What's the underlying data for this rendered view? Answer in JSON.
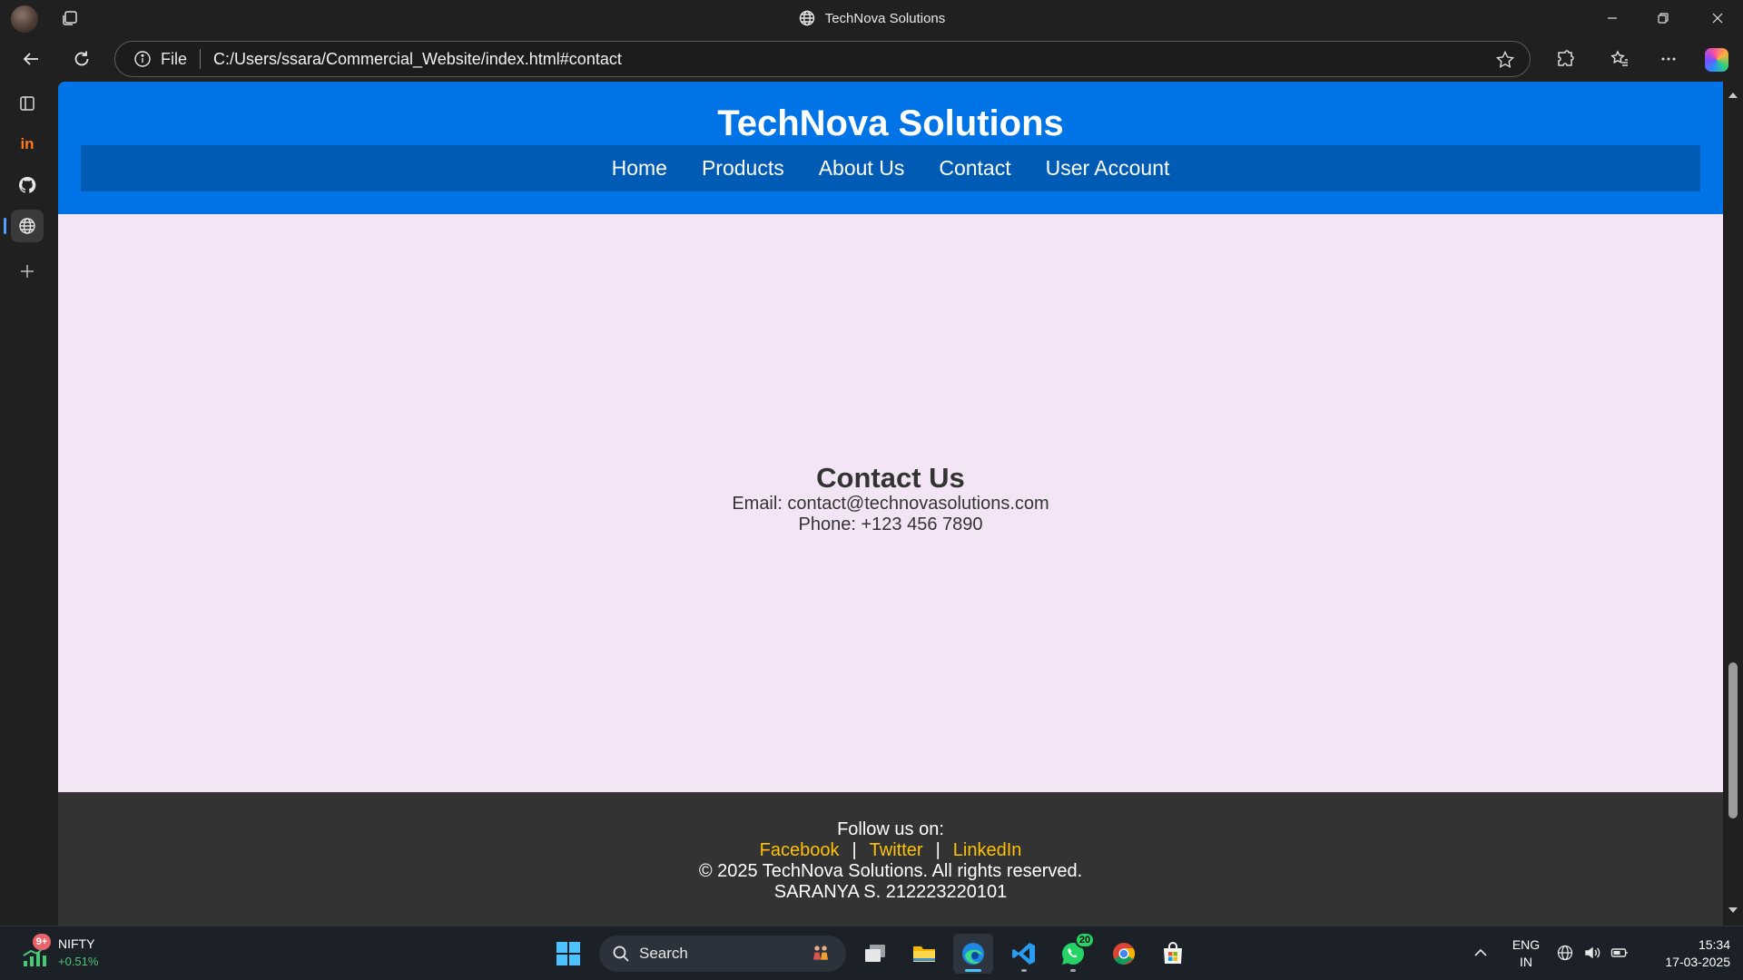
{
  "browser": {
    "window_title": "TechNova Solutions",
    "omnibox": {
      "scheme_label": "File",
      "url": "C:/Users/ssara/Commercial_Website/index.html#contact"
    }
  },
  "sidebar": {
    "items": [
      {
        "icon": "sidebar-panel-icon"
      },
      {
        "icon": "in-app-icon",
        "text": "in"
      },
      {
        "icon": "github-icon"
      },
      {
        "icon": "globe-icon"
      },
      {
        "icon": "plus-icon"
      }
    ]
  },
  "page": {
    "header": {
      "title": "TechNova Solutions",
      "nav": [
        "Home",
        "Products",
        "About Us",
        "Contact",
        "User Account"
      ]
    },
    "contact": {
      "heading": "Contact Us",
      "email": "Email: contact@technovasolutions.com",
      "phone": "Phone: +123 456 7890"
    },
    "footer": {
      "follow": "Follow us on:",
      "links": [
        "Facebook",
        "Twitter",
        "LinkedIn"
      ],
      "separator": "|",
      "copyright": "© 2025 TechNova Solutions. All rights reserved.",
      "author": "SARANYA S. 212223220101"
    },
    "colors": {
      "header_bg": "#0073e6",
      "nav_bg": "#005bb5",
      "body_bg": "#f3e5f5",
      "footer_bg": "#333333",
      "footer_link": "#ffc107"
    }
  },
  "taskbar": {
    "widget": {
      "badge": "9+",
      "name": "NIFTY",
      "change": "+0.51%"
    },
    "search_placeholder": "Search",
    "apps": [
      "task-view",
      "file-explorer",
      "edge",
      "vscode",
      "whatsapp",
      "chrome",
      "microsoft-store"
    ],
    "whatsapp_badge": "20",
    "tray": {
      "lang_top": "ENG",
      "lang_bottom": "IN",
      "time": "15:34",
      "date": "17-03-2025"
    }
  }
}
